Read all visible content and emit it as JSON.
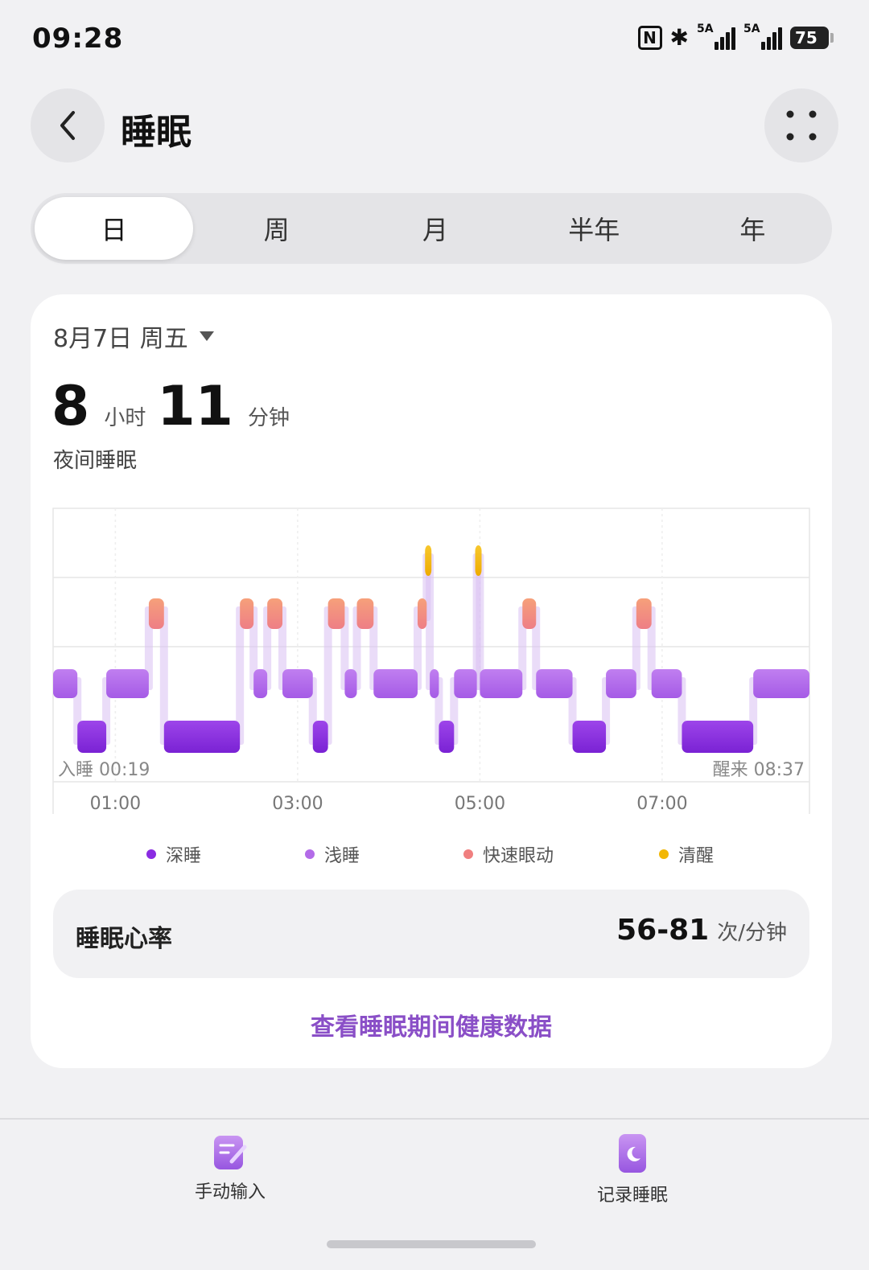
{
  "status_bar": {
    "time": "09:28",
    "nfc": "N",
    "sim1": "5A",
    "sim2": "5A",
    "battery": "75"
  },
  "header": {
    "title": "睡眠"
  },
  "tabs": [
    {
      "label": "日",
      "active": true
    },
    {
      "label": "周",
      "active": false
    },
    {
      "label": "月",
      "active": false
    },
    {
      "label": "半年",
      "active": false
    },
    {
      "label": "年",
      "active": false
    }
  ],
  "summary": {
    "date": "8月7日 周五",
    "hours": "8",
    "hours_unit": "小时",
    "minutes": "11",
    "minutes_unit": "分钟",
    "type_label": "夜间睡眠"
  },
  "chart_data": {
    "type": "hypnogram",
    "sleep_start_label": "入睡 00:19",
    "wake_label": "醒来 08:37",
    "x_ticks": [
      "01:00",
      "03:00",
      "05:00",
      "07:00"
    ],
    "stages": [
      "深睡",
      "浅睡",
      "快速眼动",
      "清醒"
    ],
    "colors": {
      "deep": "#8a2be2",
      "light": "#b36be8",
      "rem": "#f07f7f",
      "awake": "#f2b705"
    },
    "segments": [
      {
        "stage": "light",
        "start": "00:19",
        "end": "00:35"
      },
      {
        "stage": "deep",
        "start": "00:35",
        "end": "00:54"
      },
      {
        "stage": "light",
        "start": "00:54",
        "end": "01:22"
      },
      {
        "stage": "rem",
        "start": "01:22",
        "end": "01:32"
      },
      {
        "stage": "deep",
        "start": "01:32",
        "end": "02:22"
      },
      {
        "stage": "rem",
        "start": "02:22",
        "end": "02:31"
      },
      {
        "stage": "light",
        "start": "02:31",
        "end": "02:40"
      },
      {
        "stage": "rem",
        "start": "02:40",
        "end": "02:50"
      },
      {
        "stage": "light",
        "start": "02:50",
        "end": "03:10"
      },
      {
        "stage": "deep",
        "start": "03:10",
        "end": "03:20"
      },
      {
        "stage": "rem",
        "start": "03:20",
        "end": "03:31"
      },
      {
        "stage": "light",
        "start": "03:31",
        "end": "03:39"
      },
      {
        "stage": "rem",
        "start": "03:39",
        "end": "03:50"
      },
      {
        "stage": "light",
        "start": "03:50",
        "end": "04:19"
      },
      {
        "stage": "rem",
        "start": "04:19",
        "end": "04:25"
      },
      {
        "stage": "awake",
        "start": "04:25",
        "end": "04:27"
      },
      {
        "stage": "light",
        "start": "04:27",
        "end": "04:33"
      },
      {
        "stage": "deep",
        "start": "04:33",
        "end": "04:43"
      },
      {
        "stage": "light",
        "start": "04:43",
        "end": "04:58"
      },
      {
        "stage": "awake",
        "start": "04:58",
        "end": "05:00"
      },
      {
        "stage": "light",
        "start": "05:00",
        "end": "05:28"
      },
      {
        "stage": "rem",
        "start": "05:28",
        "end": "05:37"
      },
      {
        "stage": "light",
        "start": "05:37",
        "end": "06:01"
      },
      {
        "stage": "deep",
        "start": "06:01",
        "end": "06:23"
      },
      {
        "stage": "light",
        "start": "06:23",
        "end": "06:43"
      },
      {
        "stage": "rem",
        "start": "06:43",
        "end": "06:53"
      },
      {
        "stage": "light",
        "start": "06:53",
        "end": "07:13"
      },
      {
        "stage": "deep",
        "start": "07:13",
        "end": "08:00"
      },
      {
        "stage": "light",
        "start": "08:00",
        "end": "08:37"
      }
    ]
  },
  "heart_rate": {
    "label": "睡眠心率",
    "value": "56-81",
    "unit": "次/分钟"
  },
  "link": "查看睡眠期间健康数据",
  "bottom_actions": [
    {
      "label": "手动输入",
      "icon": "pencil-note-icon"
    },
    {
      "label": "记录睡眠",
      "icon": "moon-phone-icon"
    }
  ]
}
